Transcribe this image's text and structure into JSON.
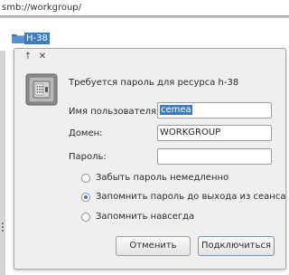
{
  "address": {
    "path": "smb://workgroup/"
  },
  "files": {
    "items": [
      {
        "label": "H-38"
      }
    ]
  },
  "dialog": {
    "prompt": "Требуется пароль для ресурса h-38",
    "username_label": "Имя пользователя:",
    "username_value": "cemea",
    "domain_label": "Домен:",
    "domain_value": "WORKGROUP",
    "password_label": "Пароль:",
    "password_value": "",
    "options": [
      {
        "label": "Забыть пароль немедленно",
        "selected": false
      },
      {
        "label": "Запомнить пароль до выхода из сеанса",
        "selected": true
      },
      {
        "label": "Запомнить навсегда",
        "selected": false
      }
    ],
    "cancel_label": "Отменить",
    "connect_label": "Подключиться"
  },
  "colors": {
    "accent": "#3d7cc1",
    "dialog_bg": "#efefef"
  },
  "icons": [
    "pin-icon",
    "close-icon",
    "folder-icon",
    "safe-lock-icon"
  ]
}
